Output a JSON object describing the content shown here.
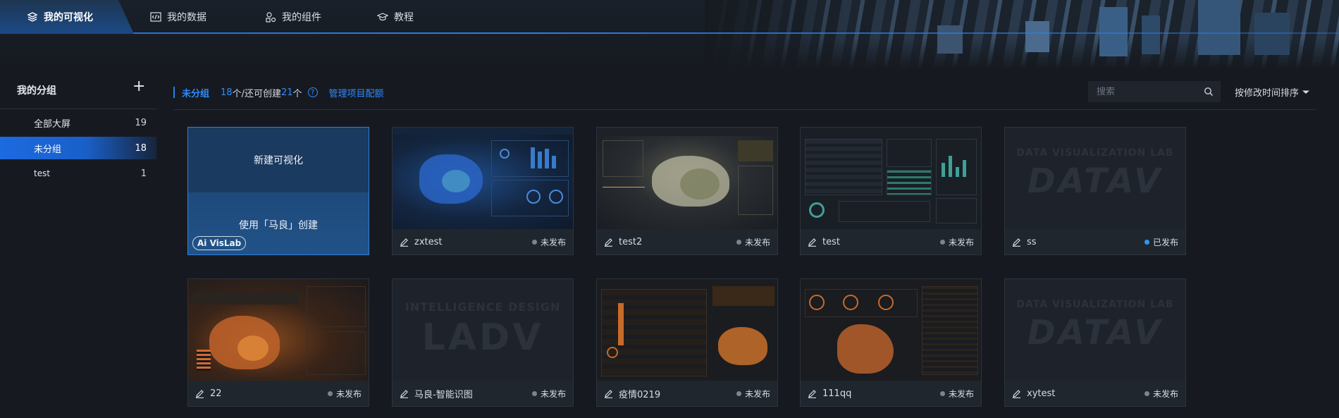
{
  "nav": {
    "tabs": [
      {
        "label": "我的可视化",
        "icon": "layers-icon"
      },
      {
        "label": "我的数据",
        "icon": "code-icon"
      },
      {
        "label": "我的组件",
        "icon": "components-icon"
      },
      {
        "label": "教程",
        "icon": "graduation-cap-icon"
      }
    ]
  },
  "sidebar": {
    "title": "我的分组",
    "add": "+",
    "items": [
      {
        "label": "全部大屏",
        "count": "19"
      },
      {
        "label": "未分组",
        "count": "18"
      },
      {
        "label": "test",
        "count": "1"
      }
    ]
  },
  "toolbar": {
    "group": "未分组",
    "count_num": "18",
    "count_text": "个/还可创建",
    "remain_num": "21",
    "remain_unit": "个",
    "help": "?",
    "manage": "管理项目配额"
  },
  "search": {
    "placeholder": "搜索"
  },
  "sort": {
    "label": "按修改时间排序"
  },
  "new_card": {
    "title": "新建可视化",
    "ai_label": "使用「马良」创建",
    "badge": "Ai VisLab"
  },
  "status": {
    "unpublished": "未发布",
    "published": "已发布"
  },
  "cards": [
    {
      "name": "zxtest",
      "status": "未发布",
      "published": false,
      "thumb": "blue-map"
    },
    {
      "name": "test2",
      "status": "未发布",
      "published": false,
      "thumb": "gold-map"
    },
    {
      "name": "test",
      "status": "未发布",
      "published": false,
      "thumb": "table-dashboard"
    },
    {
      "name": "ss",
      "status": "已发布",
      "published": true,
      "thumb": "datav-logo"
    },
    {
      "name": "22",
      "status": "未发布",
      "published": false,
      "thumb": "orange-map"
    },
    {
      "name": "马良-智能识图",
      "status": "未发布",
      "published": false,
      "thumb": "ladv-logo"
    },
    {
      "name": "疫情0219",
      "status": "未发布",
      "published": false,
      "thumb": "orange-table"
    },
    {
      "name": "111qq",
      "status": "未发布",
      "published": false,
      "thumb": "orange-dark"
    },
    {
      "name": "xytest",
      "status": "未发布",
      "published": false,
      "thumb": "datav-logo"
    }
  ],
  "thumb_text": {
    "datav_small": "DATA VISUALIZATION LAB",
    "datav_big": "DATAV",
    "ladv_small": "INTELLIGENCE DESIGN",
    "ladv_big": "LADV"
  },
  "colors": {
    "accent": "#2f8bff",
    "published": "#2b9af3",
    "unpublished": "#7c848f"
  }
}
